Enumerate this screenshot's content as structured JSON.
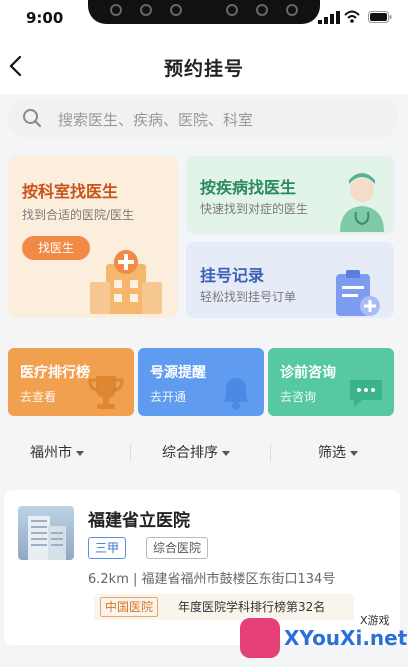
{
  "status_bar": {
    "time": "9:00"
  },
  "header": {
    "title": "预约挂号"
  },
  "search": {
    "placeholder": "搜索医生、疾病、医院、科室"
  },
  "cards": {
    "by_department": {
      "title": "按科室找医生",
      "subtitle": "找到合适的医院/医生",
      "button": "找医生"
    },
    "by_disease": {
      "title": "按疾病找医生",
      "subtitle": "快速找到对症的医生"
    },
    "records": {
      "title": "挂号记录",
      "subtitle": "轻松找到挂号订单"
    }
  },
  "tiles": [
    {
      "title": "医疗排行榜",
      "subtitle": "去查看",
      "icon": "trophy-icon"
    },
    {
      "title": "号源提醒",
      "subtitle": "去开通",
      "icon": "bell-icon"
    },
    {
      "title": "诊前咨询",
      "subtitle": "去咨询",
      "icon": "chat-icon"
    }
  ],
  "filters": {
    "city": "福州市",
    "sort": "综合排序",
    "filter": "筛选"
  },
  "hospital": {
    "name": "福建省立医院",
    "tags": [
      "三甲",
      "综合医院"
    ],
    "address": "6.2km | 福建省福州市鼓楼区东街口134号",
    "rank_tag": "中国医院",
    "rank_text": "年度医院学科排行榜第32名"
  },
  "watermark": {
    "text": "XYouXi.net",
    "small": "X游戏"
  },
  "colors": {
    "accent_orange": "#f08a45",
    "accent_green": "#2b8a5c",
    "accent_blue": "#3a5fb4"
  }
}
